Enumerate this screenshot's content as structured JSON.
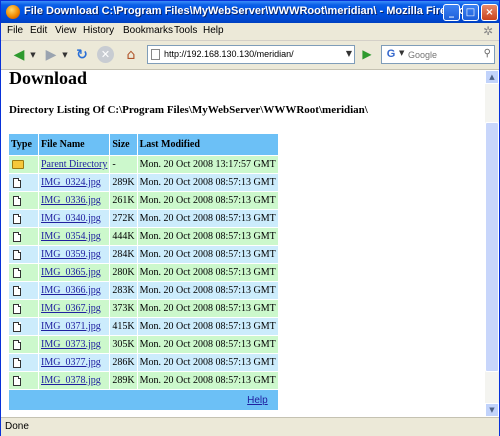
{
  "window": {
    "title": "File Download C:\\Program Files\\MyWebServer\\WWWRoot\\meridian\\ - Mozilla Firefox"
  },
  "menu": [
    "File",
    "Edit",
    "View",
    "History",
    "Bookmarks",
    "Tools",
    "Help"
  ],
  "toolbar": {
    "url": "http://192.168.130.130/meridian/",
    "search_placeholder": "Google"
  },
  "page": {
    "heading": "Download",
    "dir_heading": "Directory Listing Of C:\\Program Files\\MyWebServer\\WWWRoot\\meridian\\",
    "columns": [
      "Type",
      "File Name",
      "Size",
      "Last Modified"
    ],
    "rows": [
      {
        "type": "folder",
        "name": "Parent Directory",
        "size": "-",
        "modified": "Mon. 20 Oct 2008 13:17:57 GMT"
      },
      {
        "type": "file",
        "name": "IMG_0324.jpg",
        "size": "289K",
        "modified": "Mon. 20 Oct 2008 08:57:13 GMT"
      },
      {
        "type": "file",
        "name": "IMG_0336.jpg",
        "size": "261K",
        "modified": "Mon. 20 Oct 2008 08:57:13 GMT"
      },
      {
        "type": "file",
        "name": "IMG_0340.jpg",
        "size": "272K",
        "modified": "Mon. 20 Oct 2008 08:57:13 GMT"
      },
      {
        "type": "file",
        "name": "IMG_0354.jpg",
        "size": "444K",
        "modified": "Mon. 20 Oct 2008 08:57:13 GMT"
      },
      {
        "type": "file",
        "name": "IMG_0359.jpg",
        "size": "284K",
        "modified": "Mon. 20 Oct 2008 08:57:13 GMT"
      },
      {
        "type": "file",
        "name": "IMG_0365.jpg",
        "size": "280K",
        "modified": "Mon. 20 Oct 2008 08:57:13 GMT"
      },
      {
        "type": "file",
        "name": "IMG_0366.jpg",
        "size": "283K",
        "modified": "Mon. 20 Oct 2008 08:57:13 GMT"
      },
      {
        "type": "file",
        "name": "IMG_0367.jpg",
        "size": "373K",
        "modified": "Mon. 20 Oct 2008 08:57:13 GMT"
      },
      {
        "type": "file",
        "name": "IMG_0371.jpg",
        "size": "415K",
        "modified": "Mon. 20 Oct 2008 08:57:13 GMT"
      },
      {
        "type": "file",
        "name": "IMG_0373.jpg",
        "size": "305K",
        "modified": "Mon. 20 Oct 2008 08:57:13 GMT"
      },
      {
        "type": "file",
        "name": "IMG_0377.jpg",
        "size": "286K",
        "modified": "Mon. 20 Oct 2008 08:57:13 GMT"
      },
      {
        "type": "file",
        "name": "IMG_0378.jpg",
        "size": "289K",
        "modified": "Mon. 20 Oct 2008 08:57:13 GMT"
      }
    ],
    "help_link": "Help"
  },
  "status": {
    "text": "Done"
  },
  "colors": {
    "header": "#6CC0F6",
    "row_green": "#CCF8CC",
    "row_blue": "#CCECFC",
    "titlebar": "#0054E3"
  }
}
